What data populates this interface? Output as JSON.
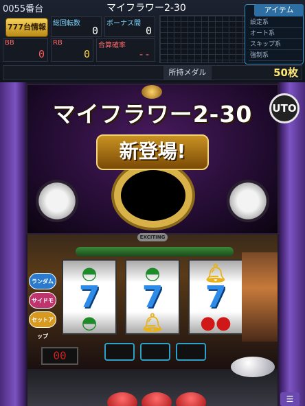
{
  "header": {
    "machine_number": "0055番台",
    "machine_title": "マイフラワー2-30"
  },
  "stats": {
    "info_button": "777台情報",
    "total_spins_label": "総回転数",
    "total_spins_value": "0",
    "bonus_interval_label": "ボーナス間",
    "bonus_interval_value": "0",
    "bb_label": "BB",
    "bb_value": "0",
    "rb_label": "RB",
    "rb_value": "0",
    "combined_rate_label": "合算確率",
    "combined_rate_value": "--"
  },
  "item_menu": {
    "tab_label": "アイテム",
    "items": [
      "設定系",
      "オート系",
      "スキップ系",
      "強制系"
    ]
  },
  "medals": {
    "label": "所持メダル",
    "value": "50枚"
  },
  "cabinet": {
    "title_banner": "マイフラワー2-30",
    "uto_badge": "UTO",
    "new_banner": "新登場!",
    "exciting_lamp": "EXCITING",
    "credit_display": "00",
    "side_buttons": [
      "ランダムモード",
      "サイドモード",
      "セットアップ"
    ]
  },
  "reels": [
    {
      "top": "melon",
      "middle": "seven",
      "bottom": "melon"
    },
    {
      "top": "melon",
      "middle": "seven",
      "bottom": "bell"
    },
    {
      "top": "bell",
      "middle": "seven",
      "bottom": "cherry"
    }
  ],
  "colors": {
    "accent_gold": "#f6d25a",
    "medal_yellow": "#ffe873",
    "cabinet_purple": "#7c53c2",
    "panel_blue": "#2d6fa3"
  }
}
